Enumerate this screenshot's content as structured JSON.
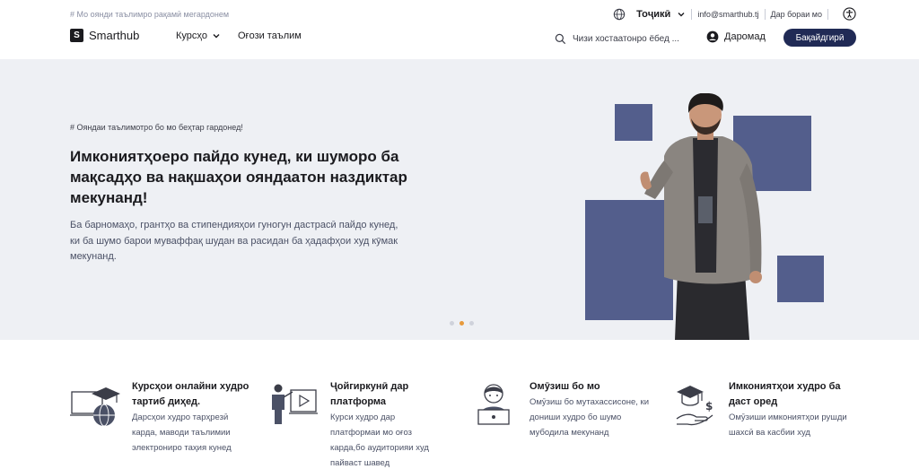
{
  "topbar": {
    "tagline": "# Мо оянди таълимро рақамӣ мегардонем",
    "language": "Тоҷикӣ",
    "email": "info@smarthub.tj",
    "about": "Дар бораи мо"
  },
  "header": {
    "logo_text": "Smarthub",
    "nav": {
      "courses": "Курсҳо",
      "start_learning": "Оғози таълим"
    },
    "search_placeholder": "Чизи хостаатонро ёбед ...",
    "login": "Даромад",
    "register": "Бақайдгирӣ"
  },
  "hero": {
    "tag": "# Ояндаи таълимотро бо мо беҳтар гардонед!",
    "title": "Имкониятҳоеро пайдо кунед, ки шуморо ба мақсадҳо ва нақшаҳои ояндаатон наздиктар мекунанд!",
    "description": "Ба барномаҳо, грантҳо ва стипендияҳои гуногун дастрасӣ пайдо кунед, ки ба шумо барои муваффақ шудан ва расидан ба ҳадафҳои худ кӯмак мекунанд.",
    "slides": {
      "count": 3,
      "active_index": 1
    }
  },
  "features": [
    {
      "title": "Курсҳои онлайни худро тартиб диҳед.",
      "description": "Дарсҳои худро тарҳрезӣ карда, маводи таълимии электрониро таҳия кунед",
      "icon": "online-course-icon"
    },
    {
      "title": "Ҷойгиркунӣ дар платформа",
      "description": "Курси худро дар платформаи мо оғоз карда,бо аудиторияи худ пайваст шавед",
      "icon": "presenter-icon"
    },
    {
      "title": "Омӯзиш бо мо",
      "description": "Омӯзиш бо мутахассисоне, ки дониши худро бо шумо мубодила мекунанд",
      "icon": "learner-laptop-icon"
    },
    {
      "title": "Имкониятҳои худро ба даст оред",
      "description": "Омӯзиши имкониятҳои рушди шахсӣ ва касбии худ",
      "icon": "graduation-money-icon"
    }
  ],
  "colors": {
    "accent": "#202a55",
    "hero_bg": "#eef0f4",
    "square": "#535e8c",
    "active_dot": "#e79a3c",
    "muted_text": "#8a8fa3"
  }
}
